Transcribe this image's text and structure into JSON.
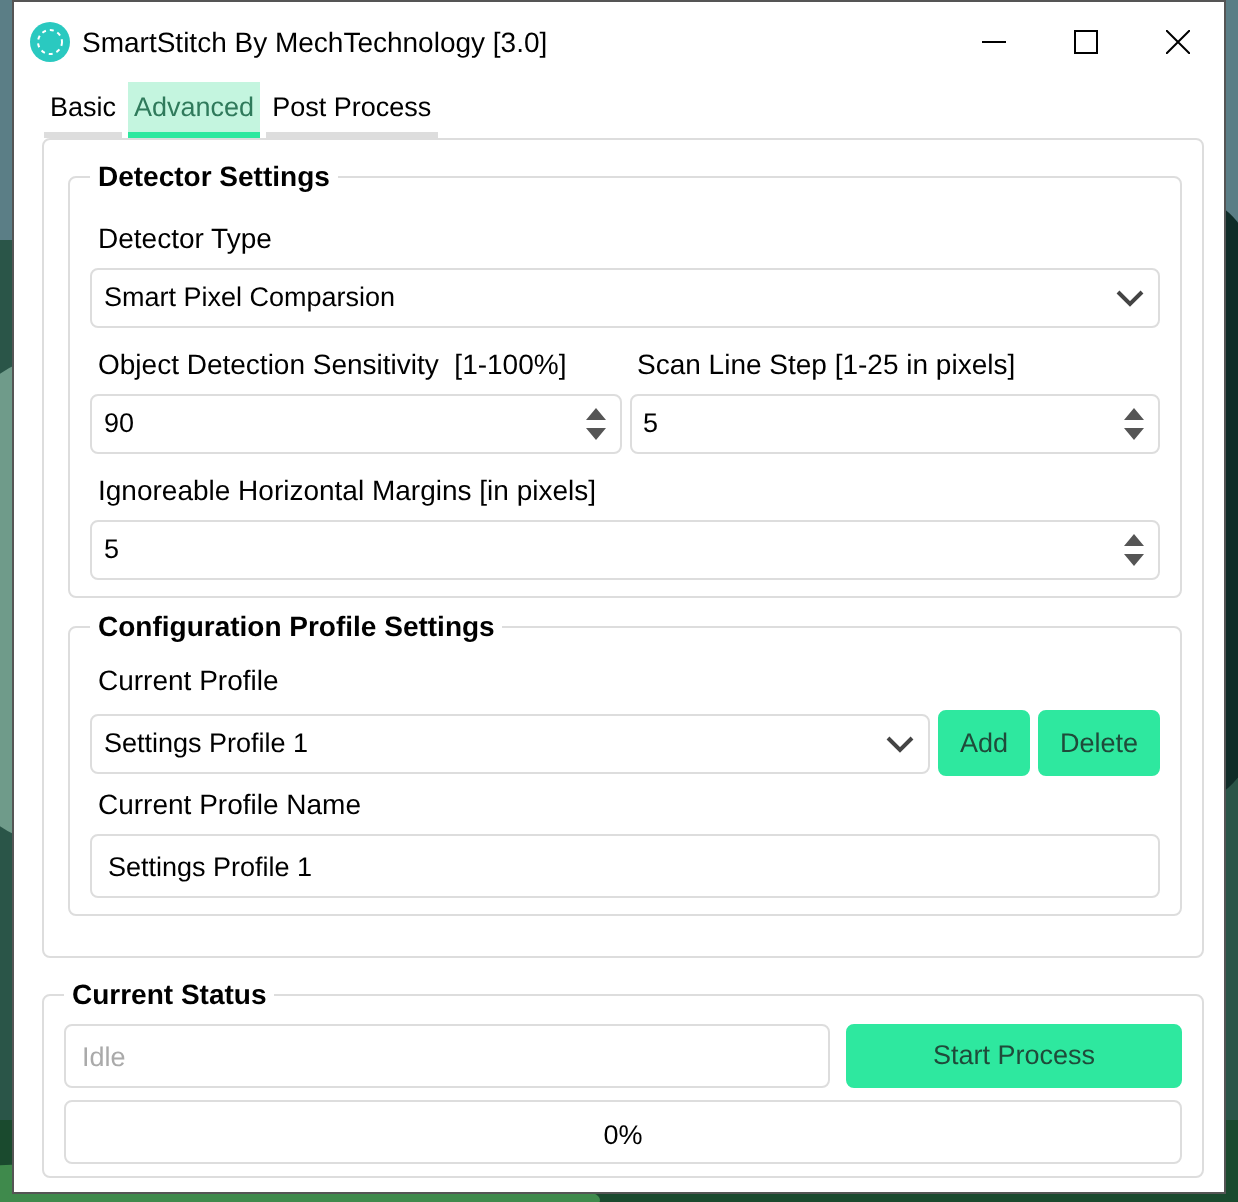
{
  "window": {
    "title": "SmartStitch By MechTechnology [3.0]"
  },
  "tabs": [
    {
      "label": "Basic",
      "selected": false
    },
    {
      "label": "Advanced",
      "selected": true
    },
    {
      "label": "Post Process",
      "selected": false
    }
  ],
  "detector_settings": {
    "title": "Detector Settings",
    "rows": [
      [
        {
          "kind": "select",
          "label": "Detector Type",
          "value": "Smart Pixel Comparsion"
        }
      ],
      [
        {
          "kind": "spin",
          "label": "Object Detection Sensitivity  [1-100%]",
          "value": "90"
        },
        {
          "kind": "spin",
          "label": "Scan Line Step [1-25 in pixels]",
          "value": "5"
        }
      ],
      [
        {
          "kind": "spin",
          "label": "Ignoreable Horizontal Margins [in pixels]",
          "value": "5"
        }
      ]
    ]
  },
  "profile_settings": {
    "title": "Configuration Profile Settings",
    "profile_label": "Current Profile",
    "profile_value": "Settings Profile 1",
    "buttons": [
      "Add",
      "Delete"
    ],
    "name_label": "Current Profile Name",
    "name_value": "Settings Profile 1"
  },
  "status": {
    "title": "Current Status",
    "placeholder": "Idle",
    "button": "Start Process",
    "progress": {
      "level": 0,
      "reading": "0%"
    }
  }
}
